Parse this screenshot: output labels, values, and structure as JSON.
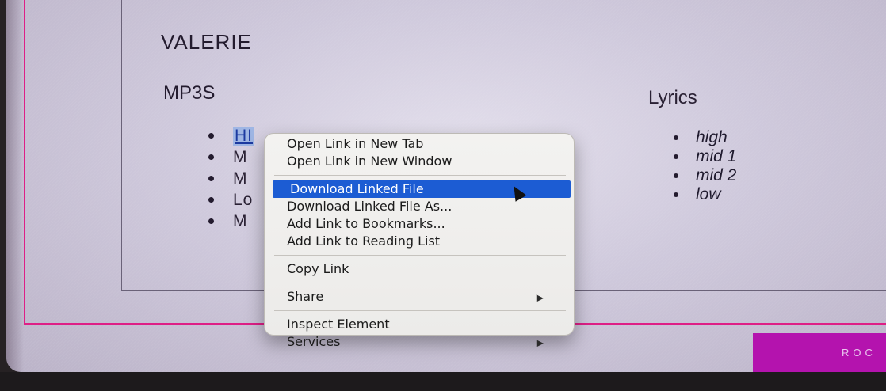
{
  "page": {
    "song_title": "VALERIE",
    "mp3s_heading": "MP3S",
    "lyrics_heading": "Lyrics",
    "mp3_links": [
      "HI",
      "M",
      "M",
      "Lo",
      "M"
    ],
    "lyrics_links": [
      "high",
      "mid 1",
      "mid 2",
      "low"
    ],
    "rock_button": "ROC"
  },
  "context_menu": {
    "items": {
      "open_new_tab": "Open Link in New Tab",
      "open_new_window": "Open Link in New Window",
      "download": "Download Linked File",
      "download_as": "Download Linked File As...",
      "bookmarks": "Add Link to Bookmarks...",
      "reading_list": "Add Link to Reading List",
      "copy_link": "Copy Link",
      "share": "Share",
      "inspect": "Inspect Element",
      "services": "Services"
    },
    "highlighted_item": "Download Linked File",
    "submenu_arrow_icon": "triangle-right-icon"
  },
  "colors": {
    "accent_pink": "#de1f86",
    "button_magenta": "#b413ae",
    "menu_highlight": "#1c5cd3",
    "background_lavender": "#cfc9dc"
  }
}
